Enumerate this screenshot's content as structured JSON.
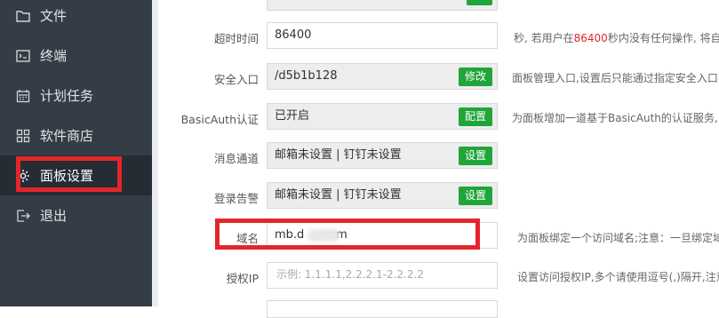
{
  "sidebar": {
    "items": [
      {
        "label": "文件",
        "icon": "folder-icon"
      },
      {
        "label": "终端",
        "icon": "terminal-icon"
      },
      {
        "label": "计划任务",
        "icon": "calendar-icon"
      },
      {
        "label": "软件商店",
        "icon": "grid-icon"
      },
      {
        "label": "面板设置",
        "icon": "gear-icon",
        "active": true
      },
      {
        "label": "退出",
        "icon": "logout-icon"
      }
    ]
  },
  "settings": {
    "timeout": {
      "label": "超时时间",
      "value": "86400",
      "tip_prefix": "秒, 若用户在",
      "tip_number": "86400",
      "tip_suffix": "秒内没有任何操作, 将自"
    },
    "security_entry": {
      "label": "安全入口",
      "value": "/d5b1b128",
      "button": "修改",
      "tip": "面板管理入口,设置后只能通过指定安全入口"
    },
    "basic_auth": {
      "label": "BasicAuth认证",
      "value": "已开启",
      "button": "配置",
      "tip": "为面板增加一道基于BasicAuth的认证服务,"
    },
    "message_channel": {
      "label": "消息通道",
      "value": "邮箱未设置 | 钉钉未设置",
      "button": "设置"
    },
    "login_alert": {
      "label": "登录告警",
      "value": "邮箱未设置 | 钉钉未设置",
      "button": "设置"
    },
    "domain": {
      "label": "域名",
      "value": "mb.d    .com",
      "tip": "为面板绑定一个访问域名;注意：一旦绑定域"
    },
    "auth_ip": {
      "label": "授权IP",
      "placeholder": "示例: 1.1.1.1,2.2.2.1-2.2.2.2",
      "tip": "设置访问授权IP,多个请使用逗号(,)隔开,注意"
    }
  },
  "colors": {
    "sidebar_bg": "#343d45",
    "accent_green": "#20a53a",
    "highlight_red": "#e3262c"
  }
}
